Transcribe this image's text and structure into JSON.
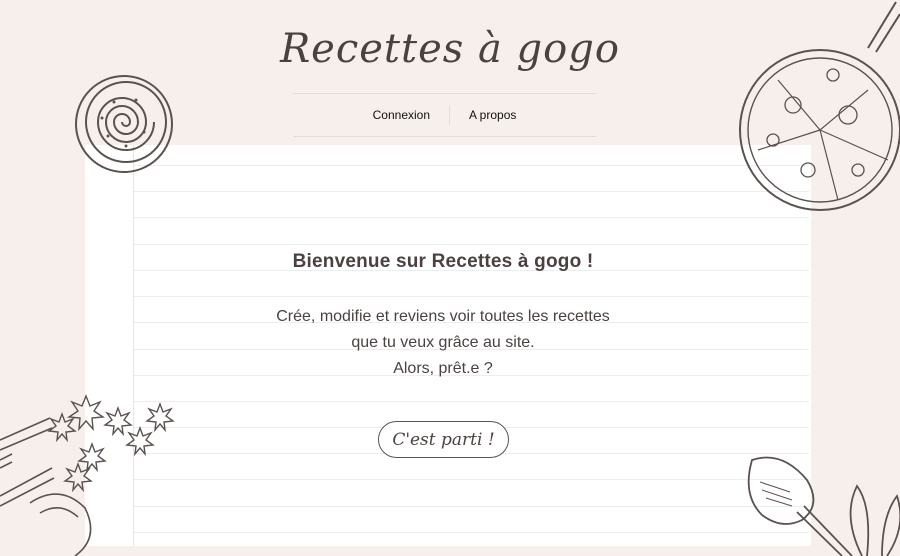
{
  "header": {
    "title": "Recettes à gogo",
    "nav": [
      {
        "label": "Connexion"
      },
      {
        "label": "A propos"
      }
    ]
  },
  "main": {
    "heading": "Bienvenue sur Recettes à gogo !",
    "lines": [
      "Crée, modifie et reviens voir toutes les recettes",
      "que tu veux grâce au site.",
      "Alors, prêt.e ?"
    ],
    "cta_label": "C'est parti !"
  },
  "decorations": {
    "top_left": "cinnamon-roll-illustration",
    "top_right": "pizza-pan-illustration",
    "bottom_left": "star-anise-cinnamon-illustration",
    "bottom_right": "wooden-spoon-leaves-illustration"
  },
  "colors": {
    "background": "#f7efeb",
    "paper": "#ffffff",
    "text": "#4a4240",
    "rule": "#e9eef1"
  }
}
